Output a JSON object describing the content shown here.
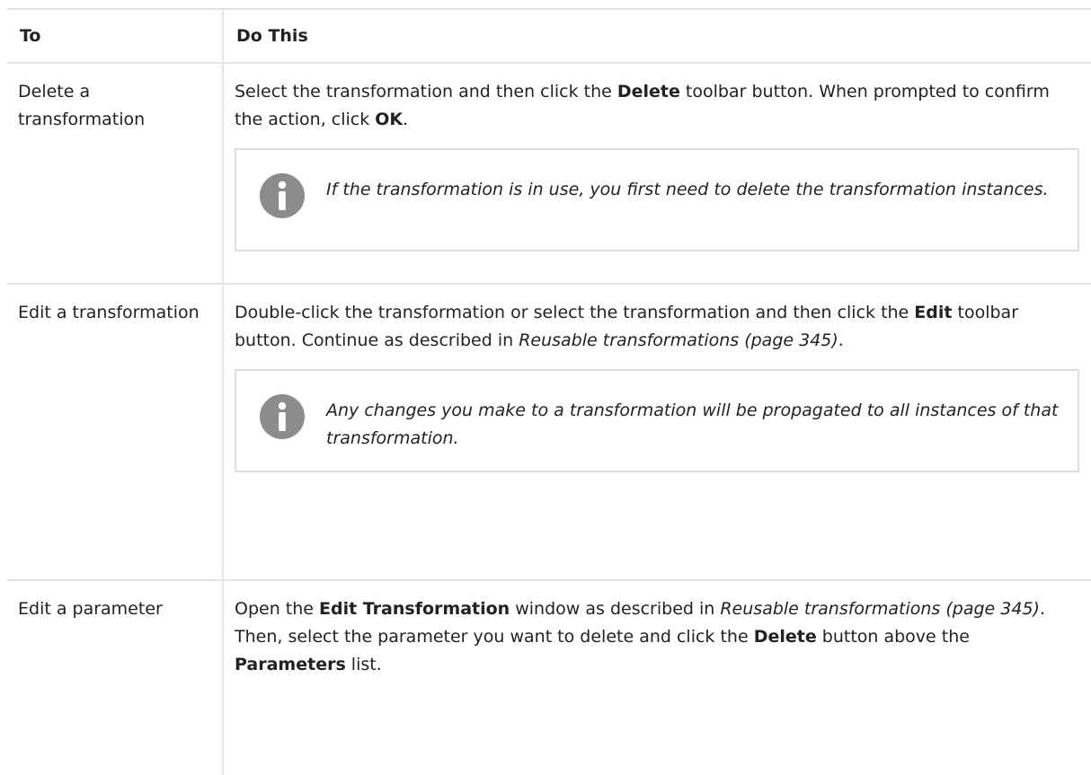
{
  "table": {
    "headers": {
      "to": "To",
      "do": "Do This"
    },
    "rows": [
      {
        "to": "Delete a transformation",
        "do": {
          "t1": "Select the transformation and then click the ",
          "b1": "Delete",
          "t2": " toolbar button. When prompted to confirm the action, click ",
          "b2": "OK",
          "t3": "."
        },
        "note": "If the transformation is in use, you first need to delete the transformation instances."
      },
      {
        "to": "Edit a transformation",
        "do": {
          "t1": "Double-click the transformation or select the transformation and then click the ",
          "b1": "Edit",
          "t2": " toolbar button. Continue as described in ",
          "i1": "Reusable transformations (page 345)",
          "t3": "."
        },
        "note": "Any changes you make to a transformation will be propagated to all instances of that transformation."
      },
      {
        "to": "Edit a parameter",
        "do": {
          "t1": "Open the ",
          "b1": "Edit Transformation",
          "t2": " window as described in ",
          "i1": "Reusable transformations (page 345)",
          "t3": ". Then, select the parameter you want to delete and click the ",
          "b2": "Delete",
          "t4": " button above the ",
          "b3": "Parameters",
          "t5": " list."
        }
      }
    ]
  },
  "note_icon": {
    "name": "info-icon",
    "color": "#8c8c8c"
  }
}
